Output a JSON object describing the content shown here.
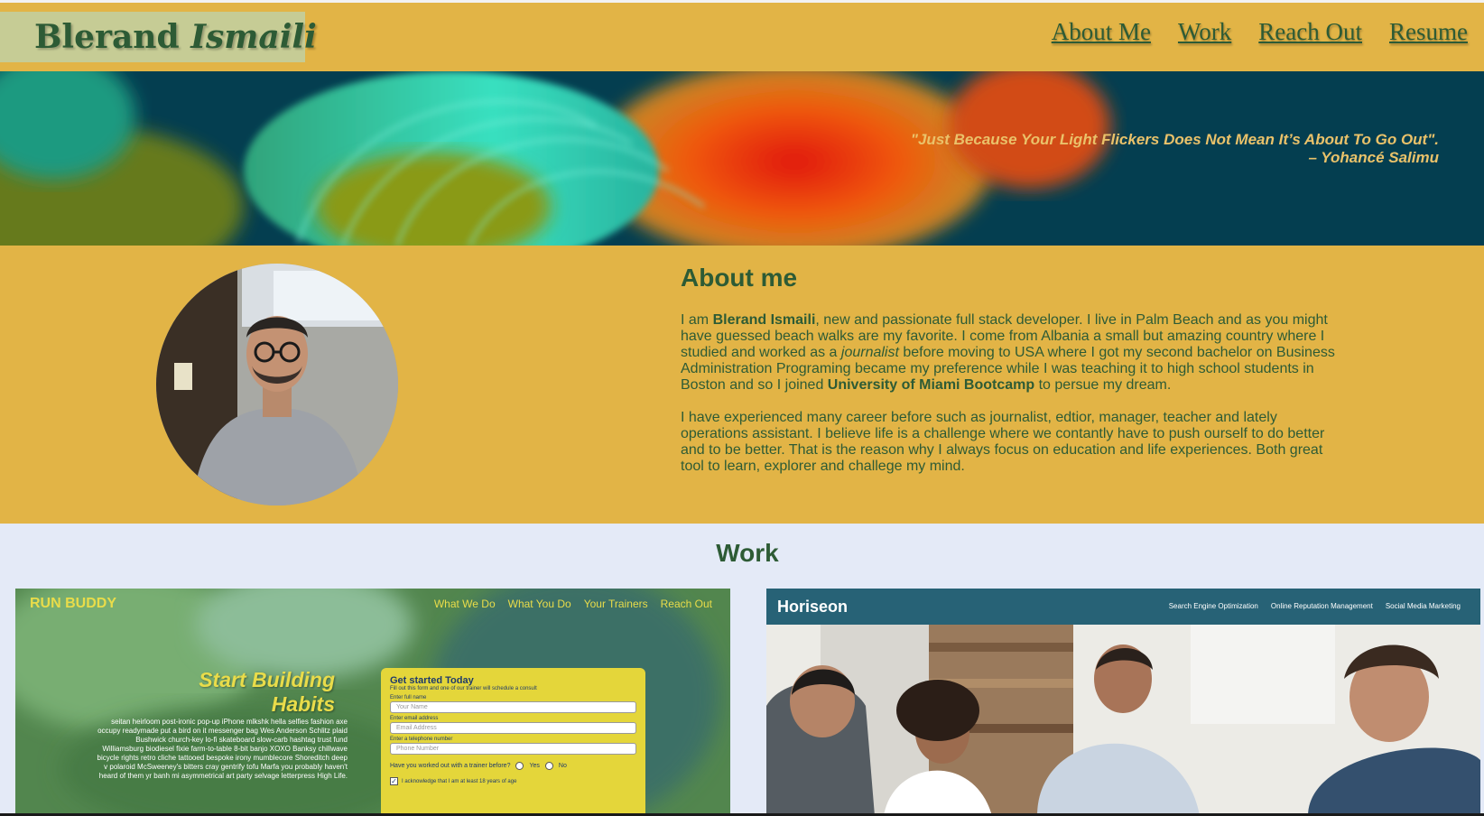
{
  "header": {
    "logo_first": "Blerand",
    "logo_last": "Ismaili",
    "nav": [
      {
        "label": "About Me"
      },
      {
        "label": "Work"
      },
      {
        "label": "Reach Out"
      },
      {
        "label": "Resume"
      }
    ]
  },
  "hero": {
    "quote": "\"Just Because Your Light Flickers Does Not Mean It’s About To Go Out\".",
    "author": "– Yohancé Salimu"
  },
  "about": {
    "title": "About me",
    "p1_start": "I am ",
    "p1_name": "Blerand Ismaili",
    "p1_mid1": ", new and passionate full stack developer. I live in Palm Beach and as you might have guessed beach walks are my favorite. I come from Albania a small but amazing country where I studied and worked as a ",
    "p1_journalist": "journalist",
    "p1_mid2": " before moving to USA where I got my second bachelor on Business Administration Programing became my preference while I was teaching it to high school students in Boston and so I joined ",
    "p1_bootcamp": "University of Miami Bootcamp",
    "p1_end": " to persue my dream.",
    "p2": "I have experienced many career before such as journalist, edtior, manager, teacher and lately operations assistant. I believe life is a challenge where we contantly have to push ourself to do better and to be better. That is the reason why I always focus on education and life experiences. Both great tool to learn, explorer and challege my mind."
  },
  "work": {
    "title": "Work",
    "run_buddy": {
      "brand": "RUN BUDDY",
      "nav": [
        "What We Do",
        "What You Do",
        "Your Trainers",
        "Reach Out"
      ],
      "headline_1": "Start Building",
      "headline_2": "Habits",
      "lorem": "seitan heirloom post-ironic pop-up iPhone mlkshk hella selfies fashion axe occupy readymade put a bird on it messenger bag Wes Anderson Schlitz plaid Bushwick church-key lo-fi skateboard slow-carb hashtag trust fund Williamsburg biodiesel fixie farm-to-table 8-bit banjo XOXO Banksy chillwave bicycle rights retro cliche tattooed bespoke irony mumblecore Shoreditch deep v polaroid McSweeney's bitters cray gentrify tofu Marfa you probably haven't heard of them yr banh mi asymmetrical art party selvage letterpress High Life.",
      "form_title": "Get started Today",
      "form_sub": "Fill out this form and one of our trainer will schedule a consult",
      "label_name": "Enter full name",
      "ph_name": "Your Name",
      "label_email": "Enter email address",
      "ph_email": "Email Address",
      "label_phone": "Enter a telephone number",
      "ph_phone": "Phone Number",
      "question": "Have you worked out with a trainer before?",
      "yes": "Yes",
      "no": "No",
      "ack": "I acknowledge that I am at least 18 years of age"
    },
    "horiseon": {
      "brand": "Horiseon",
      "nav": [
        "Search Engine Optimization",
        "Online Reputation Management",
        "Social Media Marketing"
      ]
    }
  }
}
